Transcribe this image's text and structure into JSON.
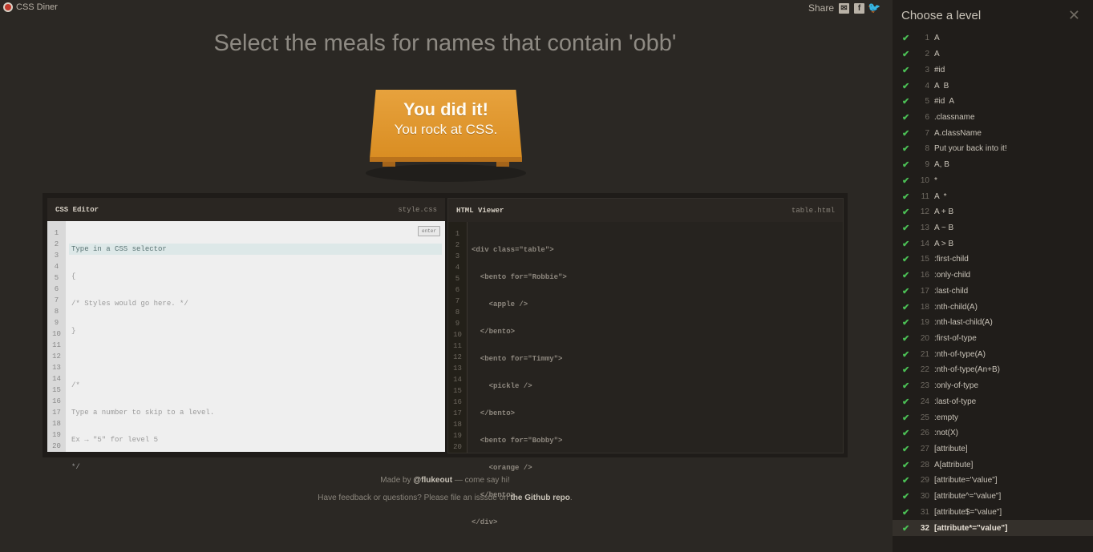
{
  "brand": {
    "name": "CSS Diner"
  },
  "share": {
    "label": "Share",
    "icons": [
      "email-icon",
      "facebook-icon",
      "twitter-icon"
    ]
  },
  "instruction": "Select the meals for names that contain 'obb'",
  "table": {
    "line1": "You did it!",
    "line2": "You rock at CSS."
  },
  "css_editor": {
    "title": "CSS Editor",
    "filename": "style.css",
    "enter_label": "enter",
    "line_numbers": [
      "1",
      "2",
      "3",
      "4",
      "5",
      "6",
      "7",
      "8",
      "9",
      "10",
      "11",
      "12",
      "13",
      "14",
      "15",
      "16",
      "17",
      "18",
      "19",
      "20"
    ],
    "lines": [
      "Type in a CSS selector",
      "{",
      "/* Styles would go here. */",
      "}",
      "",
      "/*",
      "Type a number to skip to a level.",
      "Ex → \"5\" for level 5",
      "*/"
    ]
  },
  "html_viewer": {
    "title": "HTML Viewer",
    "filename": "table.html",
    "line_numbers": [
      "1",
      "2",
      "3",
      "4",
      "5",
      "6",
      "7",
      "8",
      "9",
      "10",
      "11",
      "12",
      "13",
      "14",
      "15",
      "16",
      "17",
      "18",
      "19",
      "20"
    ],
    "lines": [
      "<div class=\"table\">",
      "  <bento for=\"Robbie\">",
      "    <apple />",
      "  </bento>",
      "  <bento for=\"Timmy\">",
      "    <pickle />",
      "  </bento>",
      "  <bento for=\"Bobby\">",
      "    <orange />",
      "  </bento>",
      "</div>"
    ]
  },
  "footer": {
    "made_by_prefix": "Made by",
    "made_by_link": "@flukeout",
    "made_by_suffix": "— come say hi!",
    "feedback_prefix": "Have feedback or questions? Please file an isssue on",
    "feedback_link": "the Github repo",
    "feedback_suffix": "."
  },
  "sidebar": {
    "title": "Choose a level",
    "current_level": 32,
    "levels": [
      {
        "num": "1",
        "selector": "A"
      },
      {
        "num": "2",
        "selector": "A"
      },
      {
        "num": "3",
        "selector": "#id"
      },
      {
        "num": "4",
        "selector": "A  B"
      },
      {
        "num": "5",
        "selector": "#id  A"
      },
      {
        "num": "6",
        "selector": ".classname"
      },
      {
        "num": "7",
        "selector": "A.className"
      },
      {
        "num": "8",
        "selector": "Put your back into it!"
      },
      {
        "num": "9",
        "selector": "A, B"
      },
      {
        "num": "10",
        "selector": "*"
      },
      {
        "num": "11",
        "selector": "A  *"
      },
      {
        "num": "12",
        "selector": "A + B"
      },
      {
        "num": "13",
        "selector": "A ~ B"
      },
      {
        "num": "14",
        "selector": "A > B"
      },
      {
        "num": "15",
        "selector": ":first-child"
      },
      {
        "num": "16",
        "selector": ":only-child"
      },
      {
        "num": "17",
        "selector": ":last-child"
      },
      {
        "num": "18",
        "selector": ":nth-child(A)"
      },
      {
        "num": "19",
        "selector": ":nth-last-child(A)"
      },
      {
        "num": "20",
        "selector": ":first-of-type"
      },
      {
        "num": "21",
        "selector": ":nth-of-type(A)"
      },
      {
        "num": "22",
        "selector": ":nth-of-type(An+B)"
      },
      {
        "num": "23",
        "selector": ":only-of-type"
      },
      {
        "num": "24",
        "selector": ":last-of-type"
      },
      {
        "num": "25",
        "selector": ":empty"
      },
      {
        "num": "26",
        "selector": ":not(X)"
      },
      {
        "num": "27",
        "selector": "[attribute]"
      },
      {
        "num": "28",
        "selector": "A[attribute]"
      },
      {
        "num": "29",
        "selector": "[attribute=\"value\"]"
      },
      {
        "num": "30",
        "selector": "[attribute^=\"value\"]"
      },
      {
        "num": "31",
        "selector": "[attribute$=\"value\"]"
      },
      {
        "num": "32",
        "selector": "[attribute*=\"value\"]"
      }
    ]
  }
}
